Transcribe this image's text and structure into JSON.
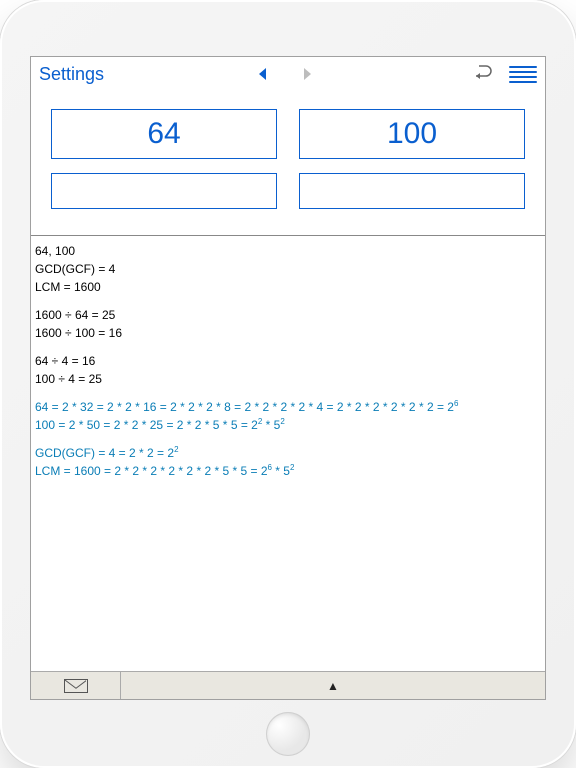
{
  "toolbar": {
    "settings_label": "Settings"
  },
  "inputs": {
    "a": "64",
    "b": "100",
    "c": "",
    "d": ""
  },
  "results": {
    "header_line": "64, 100",
    "gcd_line": "GCD(GCF) = 4",
    "lcm_line": "LCM = 1600",
    "div_lcm_1": "1600 ÷ 64 = 25",
    "div_lcm_2": "1600 ÷ 100 = 16",
    "div_gcd_1": "64 ÷ 4 = 16",
    "div_gcd_2": "100 ÷ 4 = 25",
    "factor_64_prefix": "64 = 2 * 32 = 2 * 2 * 16 = 2 * 2 * 2 * 8 = 2 * 2 * 2 * 2 * 4 = 2 * 2 * 2 * 2 * 2 * 2 = 2",
    "factor_64_exp": "6",
    "factor_100_prefix": "100 = 2 * 50 = 2 * 2 * 25 = 2 * 2 * 5 * 5 = 2",
    "factor_100_mid_exp": "2",
    "factor_100_mid": " * 5",
    "factor_100_exp2": "2",
    "gcd_factor_prefix": "GCD(GCF) = 4 = 2 * 2 = 2",
    "gcd_factor_exp": "2",
    "lcm_factor_prefix": "LCM = 1600 = 2 * 2 * 2 * 2 * 2 * 2 * 5 * 5 = 2",
    "lcm_factor_exp1": "6",
    "lcm_factor_mid": " * 5",
    "lcm_factor_exp2": "2"
  },
  "colors": {
    "accent": "#0a5fcf",
    "factor_blue": "#0a7db6"
  }
}
